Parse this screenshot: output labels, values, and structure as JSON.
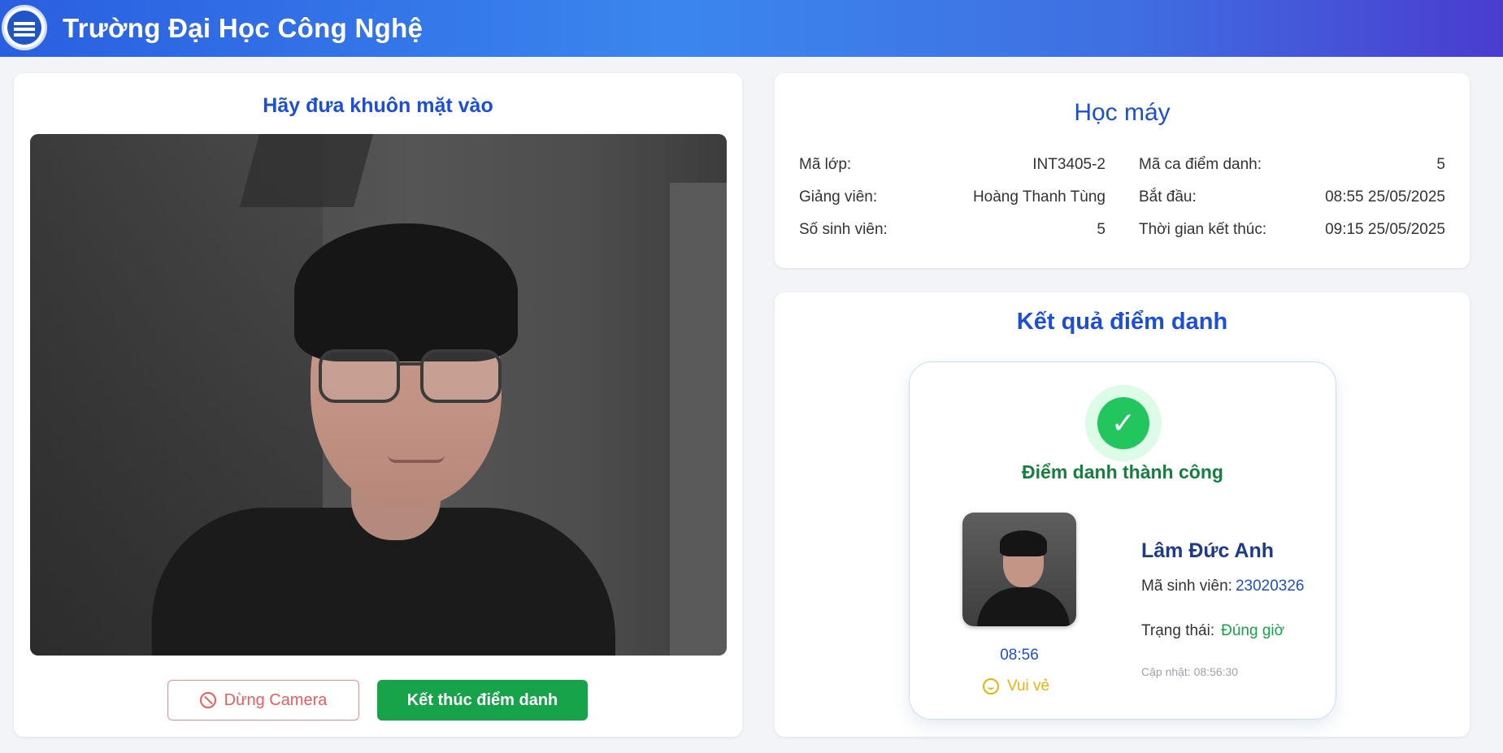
{
  "header": {
    "title": "Trường Đại Học Công Nghệ",
    "logo_icon": "university-logo"
  },
  "camera": {
    "title": "Hãy đưa khuôn mặt vào",
    "stop_label": "Dừng Camera",
    "end_label": "Kết thúc điểm danh"
  },
  "info": {
    "course": "Học máy",
    "class_code_label": "Mã lớp:",
    "class_code": "INT3405-2",
    "session_label": "Mã ca điểm danh:",
    "session": "5",
    "teacher_label": "Giảng viên:",
    "teacher": "Hoàng Thanh Tùng",
    "start_label": "Bắt đầu:",
    "start": "08:55 25/05/2025",
    "count_label": "Số sinh viên:",
    "count": "5",
    "end_label": "Thời gian kết thúc:",
    "end": "09:15 25/05/2025"
  },
  "result": {
    "title": "Kết quả điểm danh",
    "success_text": "Điểm danh thành công",
    "check_icon": "✓",
    "student_name": "Lâm Đức Anh",
    "student_id_label": "Mã sinh viên:",
    "student_id": "23020326",
    "status_label": "Trạng thái:",
    "status": "Đúng giờ",
    "updated": "Cập nhật: 08:56:30",
    "time": "08:56",
    "mood": "Vui vẻ"
  },
  "colors": {
    "accent": "#1d4ed8",
    "success": "#16a34a",
    "danger": "#ef5b5b",
    "mood": "#eab308"
  }
}
